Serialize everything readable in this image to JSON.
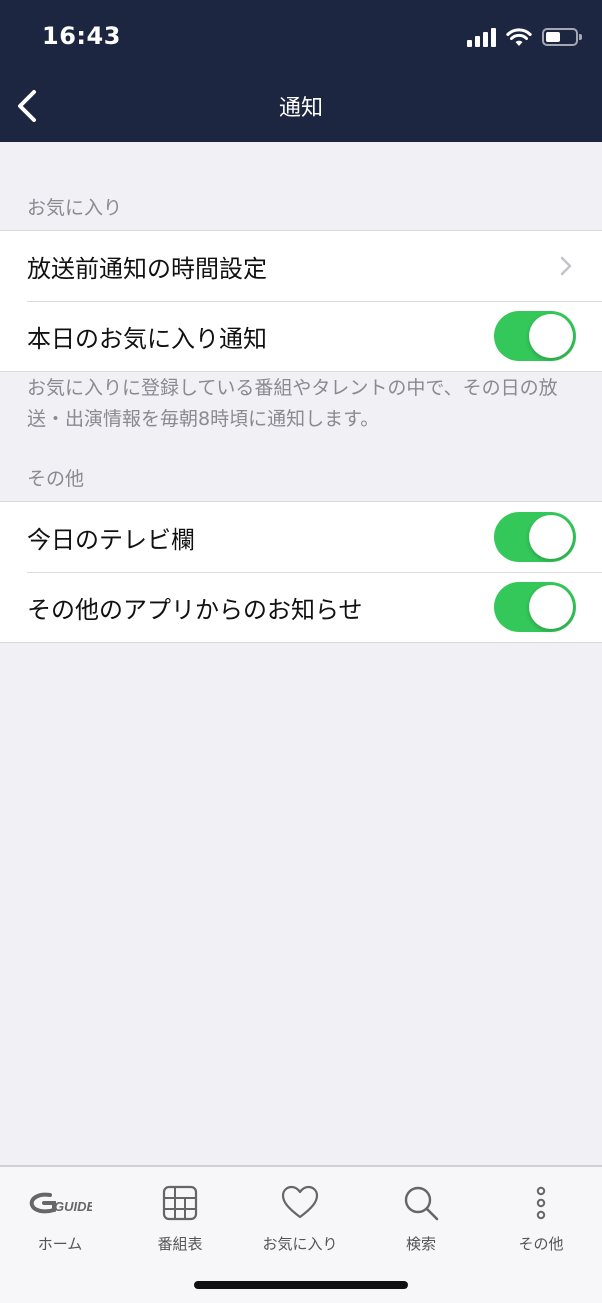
{
  "status_bar": {
    "time": "16:43"
  },
  "nav": {
    "title": "通知"
  },
  "sections": {
    "favorites": {
      "label": "お気に入り",
      "rows": [
        {
          "label": "放送前通知の時間設定"
        },
        {
          "label": "本日のお気に入り通知",
          "toggle_on": true
        }
      ],
      "note": "お気に入りに登録している番組やタレントの中で、その日の放送・出演情報を毎朝8時頃に通知します。"
    },
    "other": {
      "label": "その他",
      "rows": [
        {
          "label": "今日のテレビ欄",
          "toggle_on": true
        },
        {
          "label": "その他のアプリからのお知らせ",
          "toggle_on": true
        }
      ]
    }
  },
  "tab_bar": {
    "logo_text": "GUIDE",
    "tabs": [
      {
        "label": "ホーム",
        "icon": "gguide-logo-icon"
      },
      {
        "label": "番組表",
        "icon": "grid-icon"
      },
      {
        "label": "お気に入り",
        "icon": "heart-icon"
      },
      {
        "label": "検索",
        "icon": "search-icon"
      },
      {
        "label": "その他",
        "icon": "more-vertical-icon"
      }
    ]
  },
  "colors": {
    "header_bg": "#1d2640",
    "toggle_on": "#34c759",
    "background": "#f0f0f5"
  }
}
